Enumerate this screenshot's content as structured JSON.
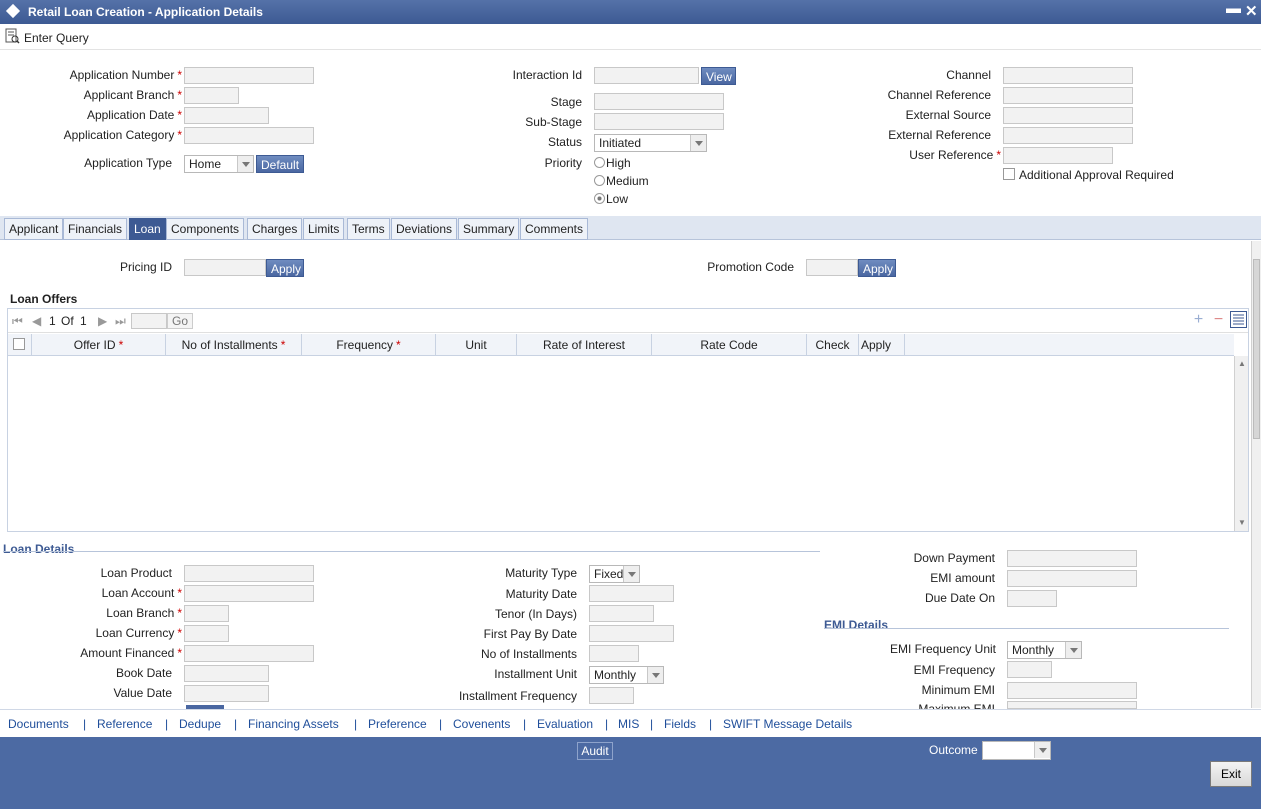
{
  "window": {
    "title": "Retail Loan Creation - Application Details",
    "minimize": "▬",
    "close": "✕"
  },
  "toolbar": {
    "enter_query": "Enter Query"
  },
  "header": {
    "application_number_label": "Application Number",
    "applicant_branch_label": "Applicant Branch",
    "application_date_label": "Application Date",
    "application_category_label": "Application Category",
    "application_type_label": "Application Type",
    "application_type_value": "Home",
    "default_button": "Default",
    "interaction_id_label": "Interaction Id",
    "view_button": "View",
    "stage_label": "Stage",
    "sub_stage_label": "Sub-Stage",
    "status_label": "Status",
    "status_value": "Initiated",
    "priority_label": "Priority",
    "priority_options": [
      "High",
      "Medium",
      "Low"
    ],
    "priority_selected": "Low",
    "channel_label": "Channel",
    "channel_reference_label": "Channel Reference",
    "external_source_label": "External Source",
    "external_reference_label": "External Reference",
    "user_reference_label": "User Reference",
    "additional_approval_label": "Additional Approval Required"
  },
  "tabs": [
    "Applicant",
    "Financials",
    "Loan",
    "Components",
    "Charges",
    "Limits",
    "Terms",
    "Deviations",
    "Summary",
    "Comments"
  ],
  "active_tab": "Loan",
  "pricing": {
    "pricing_id_label": "Pricing ID",
    "apply_button": "Apply",
    "promotion_code_label": "Promotion Code",
    "promo_apply_button": "Apply"
  },
  "loan_offers": {
    "title": "Loan Offers",
    "page_current": "1",
    "page_of": "Of",
    "page_total": "1",
    "go_button": "Go",
    "columns": [
      "Offer ID",
      "No of Installments",
      "Frequency",
      "Unit",
      "Rate of Interest",
      "Rate Code",
      "Check",
      "Apply"
    ],
    "required_columns": [
      "Offer ID",
      "No of Installments",
      "Frequency"
    ]
  },
  "loan_details": {
    "title": "Loan Details",
    "loan_product_label": "Loan Product",
    "loan_account_label": "Loan Account",
    "loan_branch_label": "Loan Branch",
    "loan_currency_label": "Loan Currency",
    "amount_financed_label": "Amount Financed",
    "book_date_label": "Book Date",
    "value_date_label": "Value Date",
    "maturity_type_label": "Maturity Type",
    "maturity_type_value": "Fixed",
    "maturity_date_label": "Maturity Date",
    "tenor_label": "Tenor (In Days)",
    "first_pay_label": "First Pay By Date",
    "no_installments_label": "No of Installments",
    "installment_unit_label": "Installment Unit",
    "installment_unit_value": "Monthly",
    "installment_frequency_label": "Installment Frequency",
    "down_payment_label": "Down Payment",
    "emi_amount_label": "EMI amount",
    "due_date_on_label": "Due Date On"
  },
  "emi_details": {
    "title": "EMI Details",
    "frequency_unit_label": "EMI Frequency Unit",
    "frequency_unit_value": "Monthly",
    "frequency_label": "EMI Frequency",
    "minimum_emi_label": "Minimum EMI",
    "maximum_emi_label": "Maximum EMI"
  },
  "links": [
    "Documents",
    "Reference",
    "Dedupe",
    "Financing Assets",
    "Preference",
    "Covenents",
    "Evaluation",
    "MIS",
    "Fields",
    "SWIFT Message Details"
  ],
  "footer": {
    "audit_button": "Audit",
    "outcome_label": "Outcome",
    "exit_button": "Exit"
  }
}
